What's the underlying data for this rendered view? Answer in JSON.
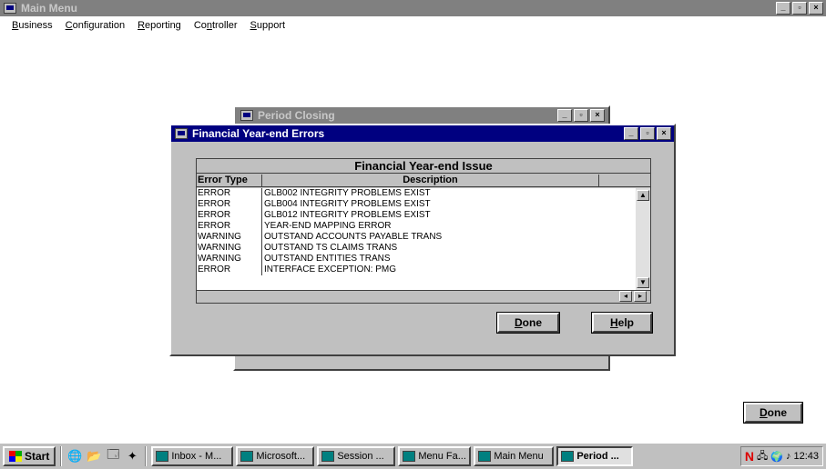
{
  "main_window": {
    "title": "Main Menu",
    "menu": [
      {
        "label": "Business",
        "accel": "B",
        "rest": "usiness"
      },
      {
        "label": "Configuration",
        "accel": "C",
        "rest": "onfiguration"
      },
      {
        "label": "Reporting",
        "accel": "R",
        "rest": "eporting"
      },
      {
        "label": "Controller",
        "pre": "Co",
        "accel": "n",
        "rest": "troller"
      },
      {
        "label": "Support",
        "accel": "S",
        "rest": "upport"
      }
    ],
    "done_label": "Done",
    "done_accel": "D",
    "done_rest": "one"
  },
  "period_window": {
    "title": "Period Closing"
  },
  "dialog": {
    "title": "Financial Year-end Errors",
    "grid_title": "Financial Year-end Issue",
    "columns": [
      "Error Type",
      "Description"
    ],
    "rows": [
      {
        "type": "ERROR",
        "desc": "GLB002 INTEGRITY PROBLEMS EXIST"
      },
      {
        "type": "ERROR",
        "desc": "GLB004 INTEGRITY PROBLEMS EXIST"
      },
      {
        "type": "ERROR",
        "desc": "GLB012 INTEGRITY PROBLEMS EXIST"
      },
      {
        "type": "ERROR",
        "desc": "YEAR-END MAPPING ERROR"
      },
      {
        "type": "WARNING",
        "desc": "OUTSTAND ACCOUNTS PAYABLE TRANS"
      },
      {
        "type": "WARNING",
        "desc": "OUTSTAND TS CLAIMS TRANS"
      },
      {
        "type": "WARNING",
        "desc": "OUTSTAND ENTITIES TRANS"
      },
      {
        "type": "ERROR",
        "desc": "INTERFACE EXCEPTION: PMG"
      }
    ],
    "done_label": "Done",
    "done_accel": "D",
    "done_rest": "one",
    "help_label": "Help",
    "help_accel": "H",
    "help_rest": "elp"
  },
  "taskbar": {
    "start_label": "Start",
    "tasks": [
      {
        "label": "Inbox - M...",
        "active": false
      },
      {
        "label": "Microsoft...",
        "active": false
      },
      {
        "label": "Session ...",
        "active": false
      },
      {
        "label": "Menu Fa...",
        "active": false
      },
      {
        "label": "Main Menu",
        "active": false
      },
      {
        "label": "Period ...",
        "active": true
      }
    ],
    "clock": "12:43"
  }
}
